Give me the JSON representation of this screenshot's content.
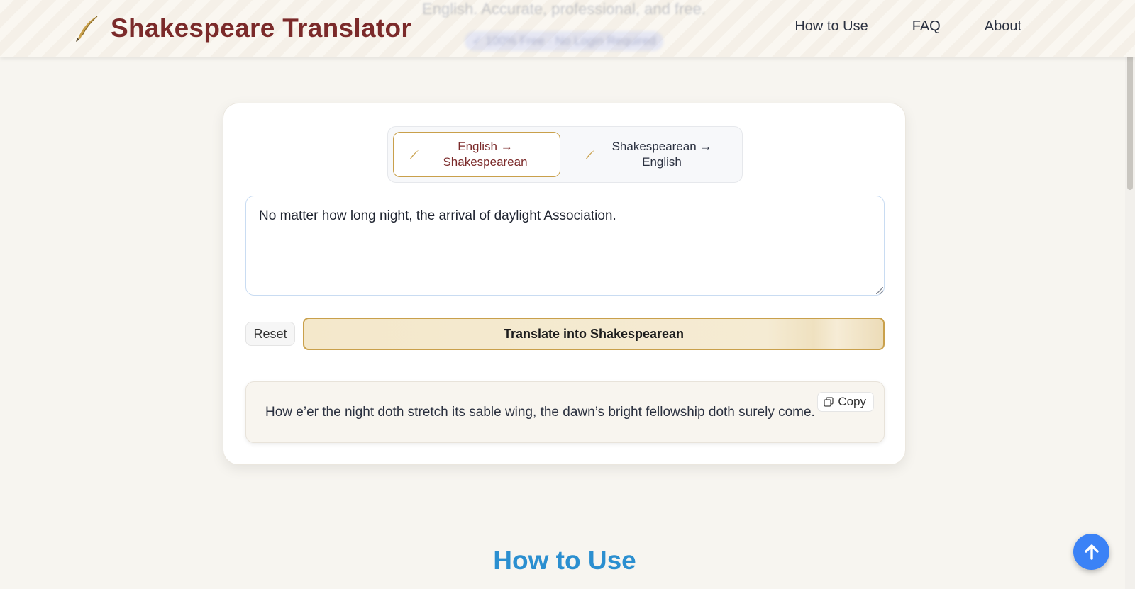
{
  "header": {
    "title": "Shakespeare Translator",
    "logo_icon": "quill-icon",
    "hero_ghost_text": "English. Accurate, professional, and free.",
    "hero_ghost_badge": "✓ 100% Free  ·  No Login Required",
    "nav": [
      {
        "label": "How to Use"
      },
      {
        "label": "FAQ"
      },
      {
        "label": "About"
      }
    ]
  },
  "translator": {
    "modes": [
      {
        "label": "English → Shakespearean",
        "active": true,
        "icon": "quill-icon"
      },
      {
        "label": "Shakespearean → English",
        "active": false,
        "icon": "quill-icon"
      }
    ],
    "input_value": "No matter how long night, the arrival of daylight Association.",
    "reset_label": "Reset",
    "translate_label": "Translate into Shakespearean",
    "output_text": "How e’er the night doth stretch its sable wing, the dawn’s bright fellowship doth surely come.",
    "copy_label": "Copy"
  },
  "section": {
    "how_to_use_title": "How to Use"
  },
  "colors": {
    "brand": "#7b2a2a",
    "gold": "#c9a04b",
    "accent_blue": "#3b82f6",
    "section_blue": "#2b8fd0"
  }
}
